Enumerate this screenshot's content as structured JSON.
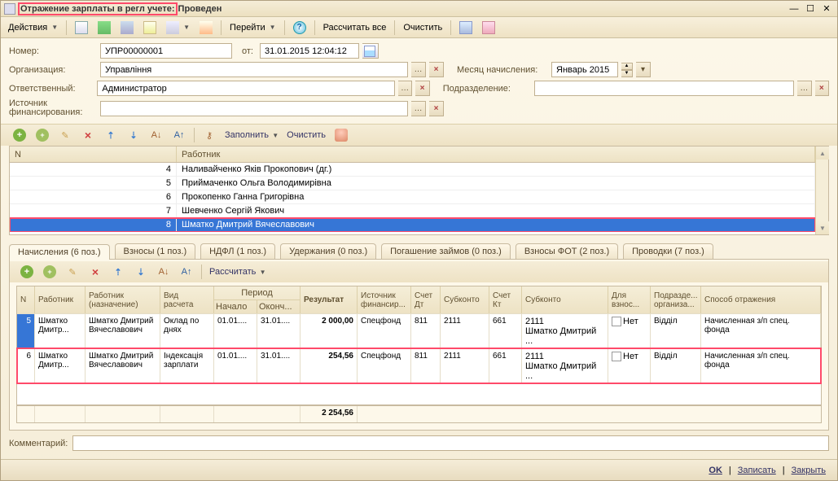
{
  "titlebar": {
    "title_1": "Отражение зарплаты в регл учете:",
    "title_2": "Проведен"
  },
  "toolbar_main": {
    "actions": "Действия",
    "goto": "Перейти",
    "calc_all": "Рассчитать все",
    "clear": "Очистить"
  },
  "form": {
    "number_lbl": "Номер:",
    "number": "УПР00000001",
    "from_lbl": "от:",
    "date": "31.01.2015 12:04:12",
    "org_lbl": "Организация:",
    "org": "Управління",
    "month_lbl": "Месяц начисления:",
    "month": "Январь 2015",
    "resp_lbl": "Ответственный:",
    "resp": "Администратор",
    "dept_lbl": "Подразделение:",
    "dept": "",
    "fund_lbl": "Источник финансирования:",
    "fund": "",
    "comment_lbl": "Комментарий:",
    "comment": ""
  },
  "grid1_tb": {
    "fill": "Заполнить",
    "clear": "Очистить"
  },
  "grid1": {
    "col_n": "N",
    "col_worker": "Работник",
    "rows": [
      {
        "n": "4",
        "name": "Наливайченко Яків Прокопович (дг.)"
      },
      {
        "n": "5",
        "name": "Приймаченко Ольга Володимирівна"
      },
      {
        "n": "6",
        "name": "Прокопенко Ганна Григорівна"
      },
      {
        "n": "7",
        "name": "Шевченко Сергій Якович"
      },
      {
        "n": "8",
        "name": "Шматко Дмитрий Вячеславович"
      }
    ]
  },
  "tabs": [
    "Начисления (6 поз.)",
    "Взносы (1 поз.)",
    "НДФЛ (1 поз.)",
    "Удержания (0 поз.)",
    "Погашение займов (0 поз.)",
    "Взносы ФОТ (2 поз.)",
    "Проводки (7 поз.)"
  ],
  "grid2_tb": {
    "calc": "Рассчитать"
  },
  "grid2_head": {
    "n": "N",
    "worker": "Работник",
    "worker_assign": "Работник (назначение)",
    "calc_type": "Вид расчета",
    "period": "Период",
    "period_from": "Начало",
    "period_to": "Оконч...",
    "result": "Результат",
    "fund": "Источник финансир...",
    "acc_dt": "Счет Дт",
    "subk1": "Субконто",
    "acc_kt": "Счет Кт",
    "subk2": "Субконто",
    "for_contr": "Для взнос...",
    "dept": "Подразде... организа...",
    "method": "Способ отражения"
  },
  "grid2_rows": [
    {
      "n": "5",
      "worker": "Шматко Дмитр...",
      "worker_full": "Шматко Дмитрий Вячеславович",
      "ctype": "Оклад по днях",
      "from": "01.01....",
      "to": "31.01....",
      "res": "2 000,00",
      "fund": "Спецфонд",
      "dt": "811",
      "sk1": "2111",
      "kt": "661",
      "sk2a": "2111",
      "sk2b": "Шматко Дмитрий ...",
      "contr": "Нет",
      "dept": "Відділ",
      "method": "Начисленная з/п спец. фонда"
    },
    {
      "n": "6",
      "worker": "Шматко Дмитр...",
      "worker_full": "Шматко Дмитрий Вячеславович",
      "ctype": "Індексація зарплати",
      "from": "01.01....",
      "to": "31.01....",
      "res": "254,56",
      "fund": "Спецфонд",
      "dt": "811",
      "sk1": "2111",
      "kt": "661",
      "sk2a": "2111",
      "sk2b": "Шматко Дмитрий ...",
      "contr": "Нет",
      "dept": "Відділ",
      "method": "Начисленная з/п спец. фонда"
    }
  ],
  "grid2_total": "2 254,56",
  "footer": {
    "ok": "OK",
    "save": "Записать",
    "close": "Закрыть"
  }
}
